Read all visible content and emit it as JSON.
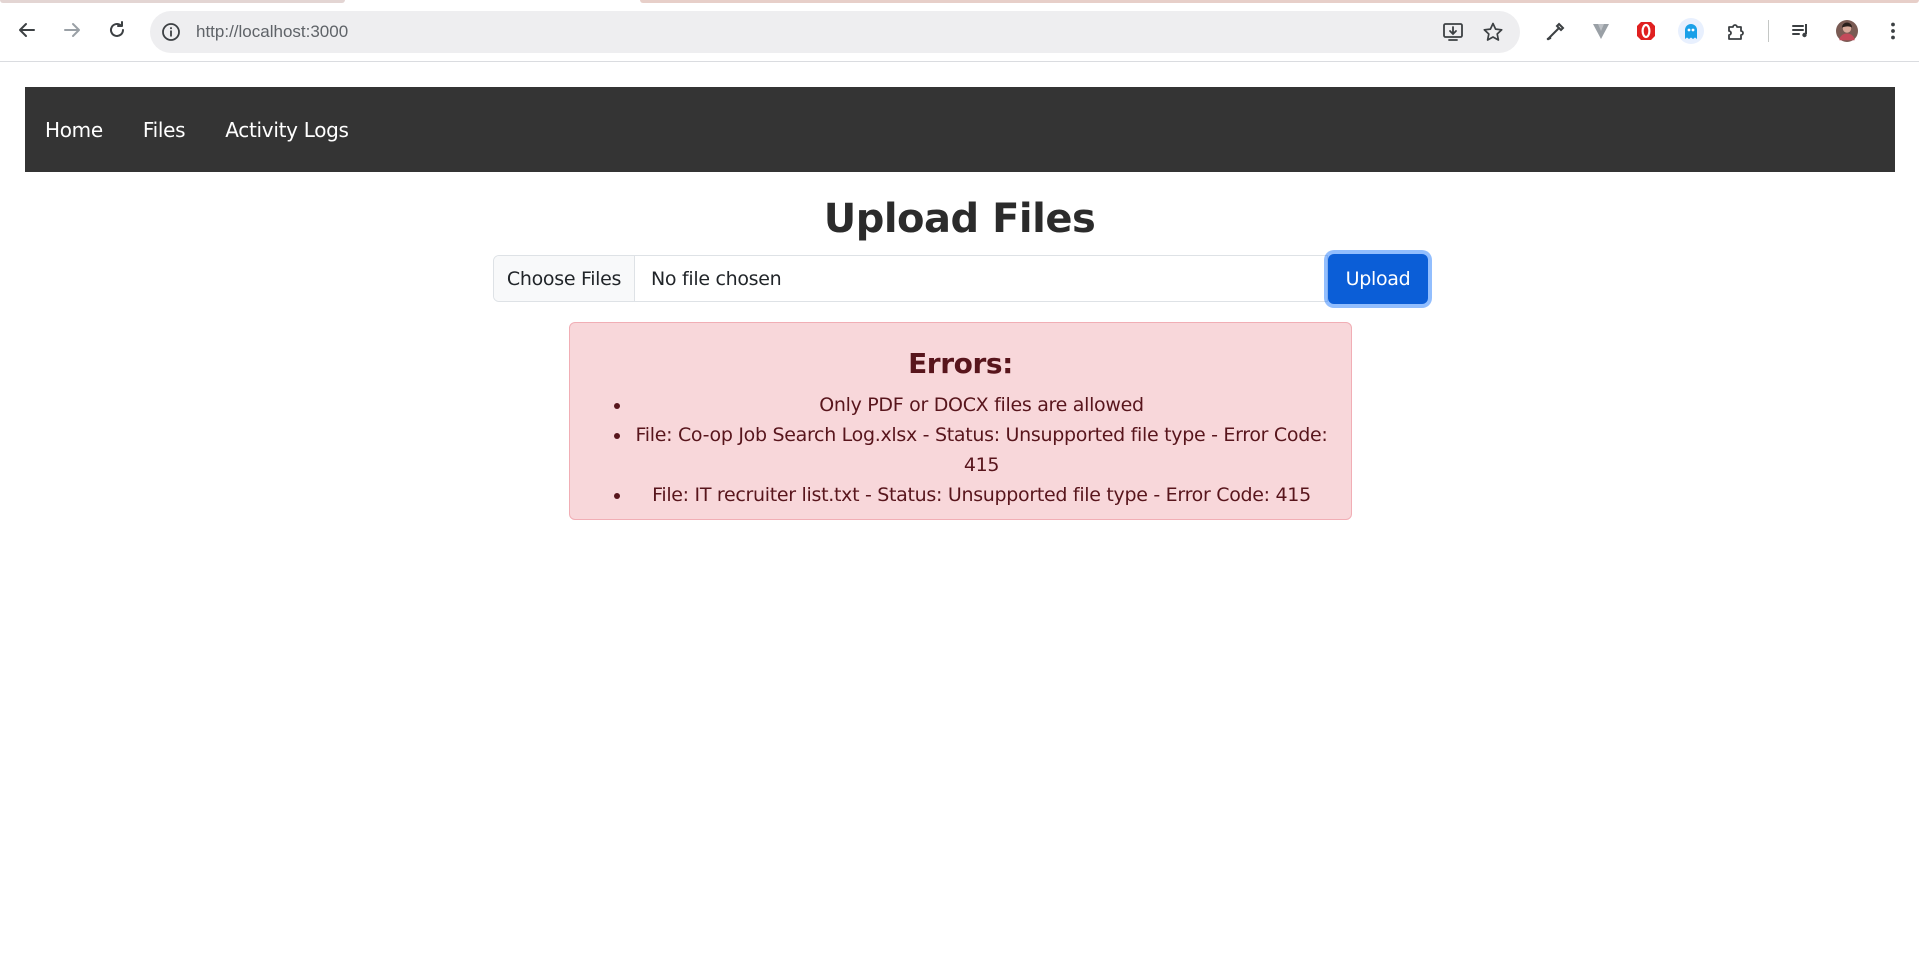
{
  "browser": {
    "url": "http://localhost:3000",
    "icons": {
      "back": "arrow-left-icon",
      "forward": "arrow-right-icon",
      "reload": "reload-icon",
      "site_info": "info-icon",
      "install": "install-app-icon",
      "bookmark": "star-icon",
      "eyedropper": "eyedropper-icon",
      "ext_v": "v-extension-icon",
      "ext_opera": "opera-extension-icon",
      "ext_ghost": "ghost-extension-icon",
      "extensions": "puzzle-icon",
      "media": "media-control-icon",
      "profile": "avatar",
      "menu": "kebab-menu-icon"
    }
  },
  "navbar": {
    "items": [
      {
        "label": "Home"
      },
      {
        "label": "Files"
      },
      {
        "label": "Activity Logs"
      }
    ]
  },
  "main": {
    "title": "Upload Files",
    "file_input": {
      "button_label": "Choose Files",
      "status": "No file chosen"
    },
    "upload_button": "Upload"
  },
  "errors": {
    "heading": "Errors:",
    "items": [
      "Only PDF or DOCX files are allowed",
      "File: Co-op Job Search Log.xlsx - Status: Unsupported file type - Error Code: 415",
      "File: IT recruiter list.txt - Status: Unsupported file type - Error Code: 415"
    ]
  },
  "colors": {
    "navbar_bg": "#343434",
    "primary": "#0b5ed7",
    "alert_bg": "#f8d7da",
    "alert_text": "#58151c"
  }
}
